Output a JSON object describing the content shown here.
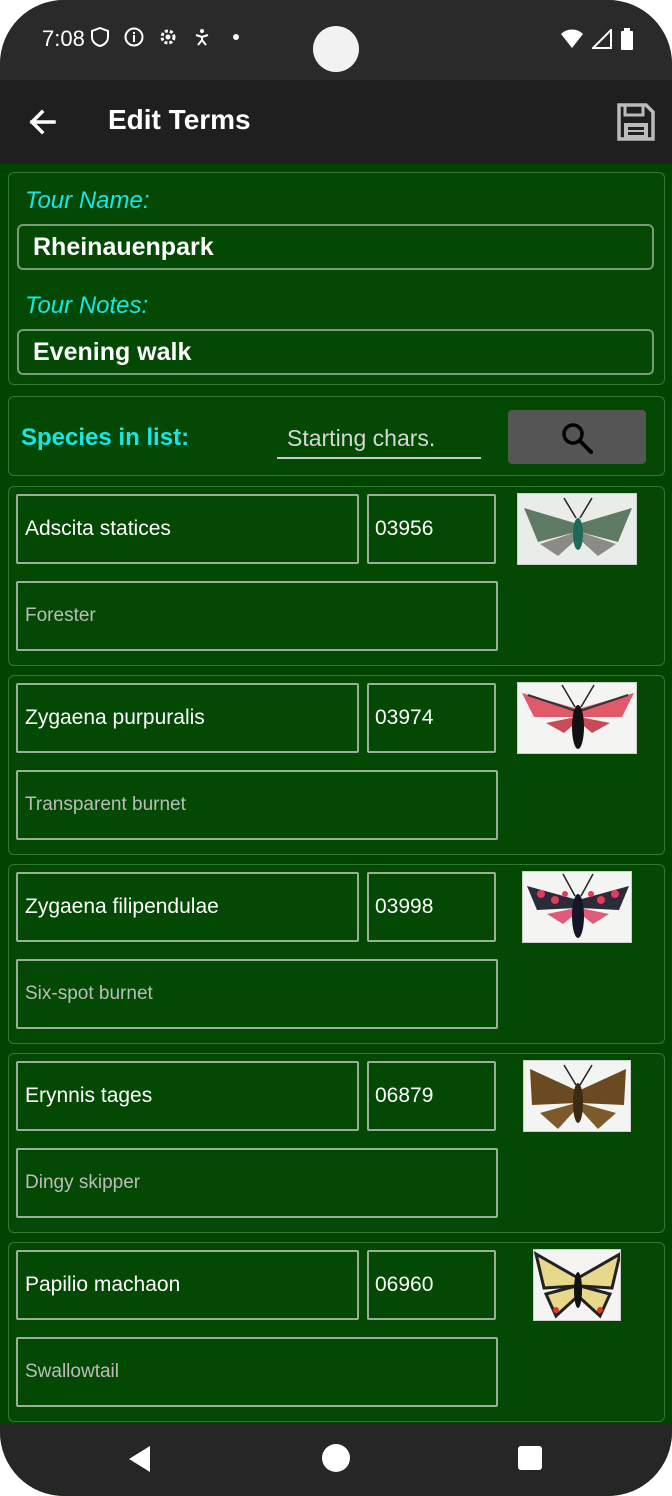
{
  "status_bar": {
    "time": "7:08",
    "left_icons": [
      "shield-icon",
      "info-icon",
      "gear-icon",
      "accessibility-icon",
      "dot-icon"
    ],
    "right_icons": [
      "wifi-icon",
      "signal-icon",
      "battery-icon"
    ]
  },
  "app_bar": {
    "title": "Edit Terms",
    "back_icon": "arrow-left-icon",
    "save_icon": "floppy-disk-icon"
  },
  "tour": {
    "name_label": "Tour Name:",
    "name_value": "Rheinauenpark",
    "notes_label": "Tour Notes:",
    "notes_value": "Evening walk"
  },
  "search": {
    "label": "Species in list:",
    "placeholder": "Starting chars.",
    "button_icon": "search-icon"
  },
  "species": [
    {
      "scientific": "Adscita statices",
      "code": "03956",
      "common": "Forester",
      "thumb_desc": "green moth"
    },
    {
      "scientific": "Zygaena purpuralis",
      "code": "03974",
      "common": "Transparent burnet",
      "thumb_desc": "red burnet moth"
    },
    {
      "scientific": "Zygaena filipendulae",
      "code": "03998",
      "common": "Six-spot burnet",
      "thumb_desc": "spotted burnet moth"
    },
    {
      "scientific": "Erynnis tages",
      "code": "06879",
      "common": "Dingy skipper",
      "thumb_desc": "brown skipper"
    },
    {
      "scientific": "Papilio machaon",
      "code": "06960",
      "common": "Swallowtail",
      "thumb_desc": "yellow swallowtail"
    }
  ],
  "colors": {
    "background": "#004400",
    "panel": "#034803",
    "accent_cyan": "#18e6e6",
    "appbar": "#1f1f1f"
  },
  "nav_bar": {
    "back_icon": "triangle-back-icon",
    "home_icon": "circle-home-icon",
    "recents_icon": "square-recents-icon"
  }
}
